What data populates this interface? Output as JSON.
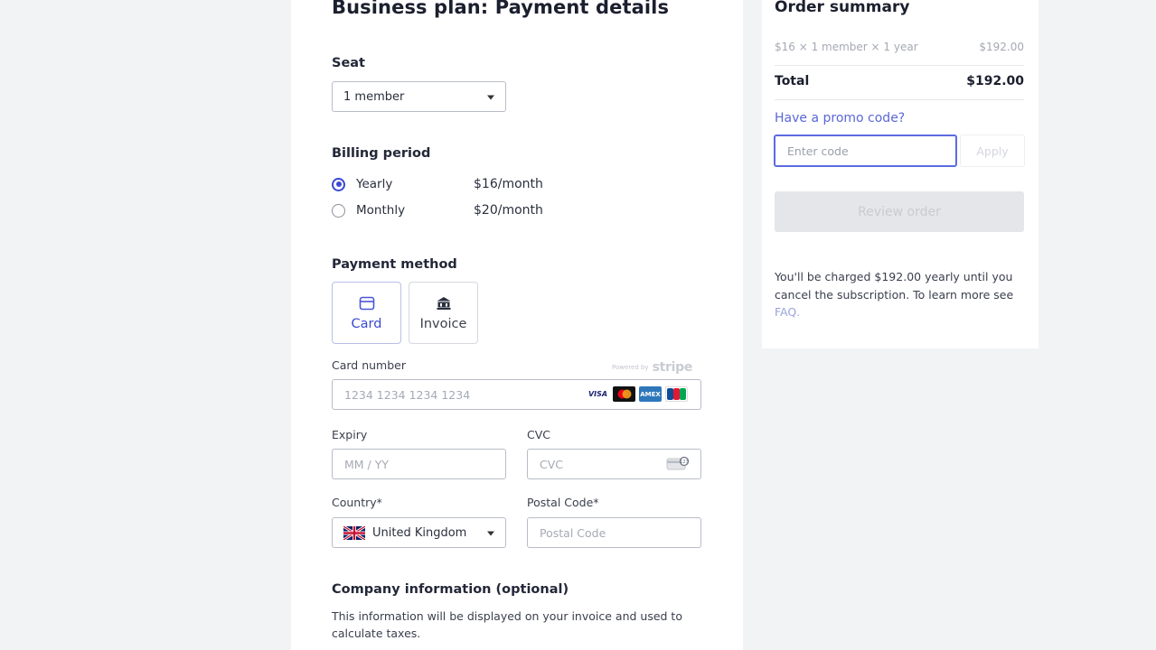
{
  "main": {
    "title": "Business plan: Payment details",
    "seat": {
      "label": "Seat",
      "value": "1 member"
    },
    "billing": {
      "label": "Billing period",
      "options": [
        {
          "label": "Yearly",
          "price": "$16/month",
          "selected": true
        },
        {
          "label": "Monthly",
          "price": "$20/month",
          "selected": false
        }
      ]
    },
    "payment": {
      "label": "Payment method",
      "methods": [
        {
          "label": "Card",
          "icon": "card-icon",
          "active": true
        },
        {
          "label": "Invoice",
          "icon": "bank-icon",
          "active": false
        }
      ],
      "powered_by": "Powered by",
      "stripe": "stripe",
      "card_number": {
        "label": "Card number",
        "placeholder": "1234 1234 1234 1234"
      },
      "brands": [
        "VISA",
        "Mastercard",
        "AMEX",
        "JCB"
      ],
      "expiry": {
        "label": "Expiry",
        "placeholder": "MM / YY"
      },
      "cvc": {
        "label": "CVC",
        "placeholder": "CVC"
      },
      "country": {
        "label": "Country*",
        "value": "United Kingdom"
      },
      "postal": {
        "label": "Postal Code*",
        "placeholder": "Postal Code"
      }
    },
    "company": {
      "label": "Company information (optional)",
      "description": "This information will be displayed on your invoice and used to calculate taxes."
    }
  },
  "summary": {
    "title": "Order summary",
    "line_item": {
      "label": "$16 × 1 member × 1 year",
      "amount": "$192.00"
    },
    "total": {
      "label": "Total",
      "amount": "$192.00"
    },
    "promo_link": "Have a promo code?",
    "promo_placeholder": "Enter code",
    "apply_label": "Apply",
    "review_label": "Review order",
    "charge_note": "You'll be charged $192.00 yearly until you cancel the subscription. To learn more see",
    "faq_label": "FAQ."
  },
  "colors": {
    "accent": "#3b49d1",
    "promo_border": "#5b6be0",
    "background": "#f2f3f5"
  }
}
